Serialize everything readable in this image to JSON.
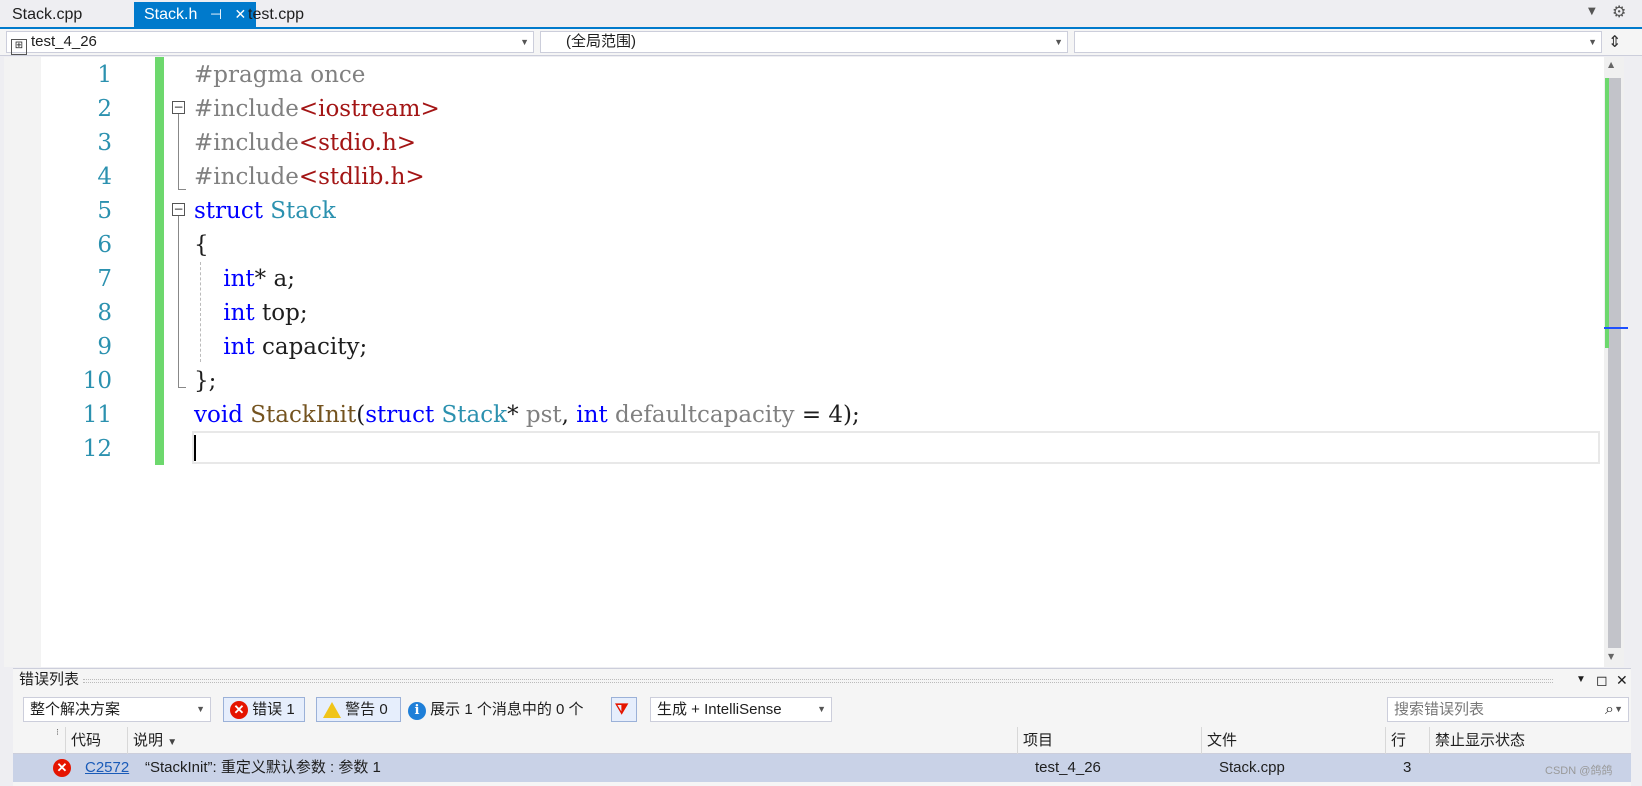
{
  "tabs": [
    {
      "label": "Stack.cpp",
      "active": false
    },
    {
      "label": "Stack.h",
      "active": true,
      "pin_glyph": "⊣",
      "close_glyph": "✕"
    },
    {
      "label": "test.cpp",
      "active": false
    }
  ],
  "navbar": {
    "project": "test_4_26",
    "scope": "(全局范围)",
    "member": ""
  },
  "editor": {
    "line_numbers": [
      "1",
      "2",
      "3",
      "4",
      "5",
      "6",
      "7",
      "8",
      "9",
      "10",
      "11",
      "12"
    ],
    "lines": [
      "#pragma once",
      "#include<iostream>",
      "#include<stdio.h>",
      "#include<stdlib.h>",
      "struct Stack",
      "{",
      "    int* a;",
      "    int top;",
      "    int capacity;",
      "};",
      "void StackInit(struct Stack* pst, int defaultcapacity = 4);",
      ""
    ],
    "fold_glyph": "−"
  },
  "error_list": {
    "title": "错误列表",
    "scope_filter": "整个解决方案",
    "errors_button": "错误 1",
    "warnings_button": "警告 0",
    "messages_button": "展示 1 个消息中的 0 个",
    "build_filter": "生成 + IntelliSense",
    "search_placeholder": "搜索错误列表",
    "columns": {
      "code": "代码",
      "description": "说明",
      "project": "项目",
      "file": "文件",
      "line": "行",
      "suppression": "禁止显示状态"
    },
    "rows": [
      {
        "code": "C2572",
        "description": "“StackInit”: 重定义默认参数 : 参数 1",
        "project": "test_4_26",
        "file": "Stack.cpp",
        "line": "3",
        "suppression": ""
      }
    ]
  },
  "watermark": "CSDN @鸽鸽",
  "colors": {
    "accent": "#007acc",
    "keyword": "#0000ff",
    "preprocessor": "#808080",
    "string": "#a31515",
    "type": "#2b91af",
    "change_bar": "#6dd86d",
    "error": "#e51400"
  }
}
